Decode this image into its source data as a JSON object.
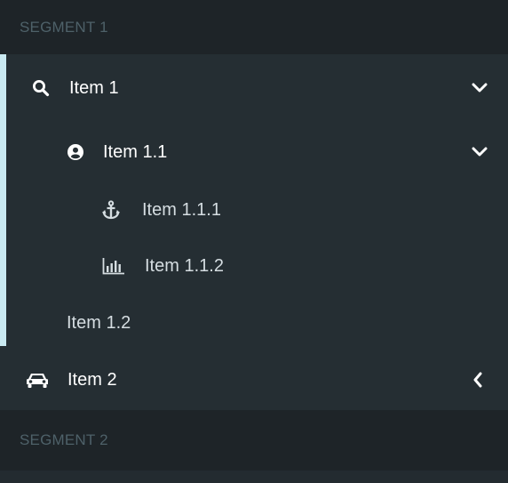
{
  "segments": [
    {
      "label": "SEGMENT 1"
    },
    {
      "label": "SEGMENT 2"
    }
  ],
  "items": [
    {
      "label": "Item 1",
      "icon": "search-icon",
      "chevron": "chevron-down-icon"
    },
    {
      "label": "Item 1.1",
      "icon": "user-circle-icon",
      "chevron": "chevron-down-icon"
    },
    {
      "label": "Item 1.1.1",
      "icon": "anchor-icon"
    },
    {
      "label": "Item 1.1.2",
      "icon": "bar-chart-icon"
    },
    {
      "label": "Item 1.2"
    },
    {
      "label": "Item 2",
      "icon": "car-icon",
      "chevron": "chevron-left-icon"
    }
  ],
  "colors": {
    "sidebar_bg": "#252e33",
    "segment_bg": "#1e2428",
    "segment_text": "#4e6169",
    "active_indicator": "#c9e9f1",
    "text": "#ffffff"
  }
}
